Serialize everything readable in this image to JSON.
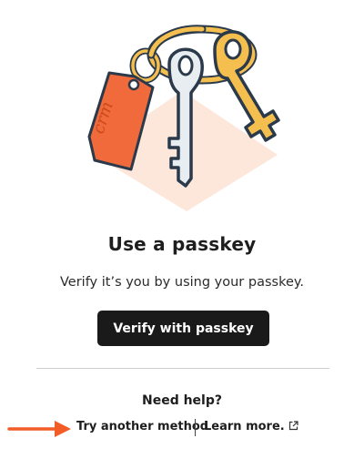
{
  "heading": {
    "title": "Use a passkey",
    "subtitle": "Verify it’s you by using your passkey."
  },
  "actions": {
    "verify_label": "Verify with passkey"
  },
  "help": {
    "heading": "Need help?",
    "try_another": "Try another method",
    "learn_more": "Learn more."
  },
  "illustration": {
    "tag_text": "crm",
    "icons": [
      "keyring-illustration",
      "external-link-icon",
      "arrow-right-icon"
    ],
    "colors": {
      "tag": "#f06a3b",
      "brass_key": "#f5bf4f",
      "silver_key": "#e8edf2",
      "outline": "#2b3a4a",
      "shadow": "#fde2d6",
      "arrow": "#f25c27"
    }
  }
}
